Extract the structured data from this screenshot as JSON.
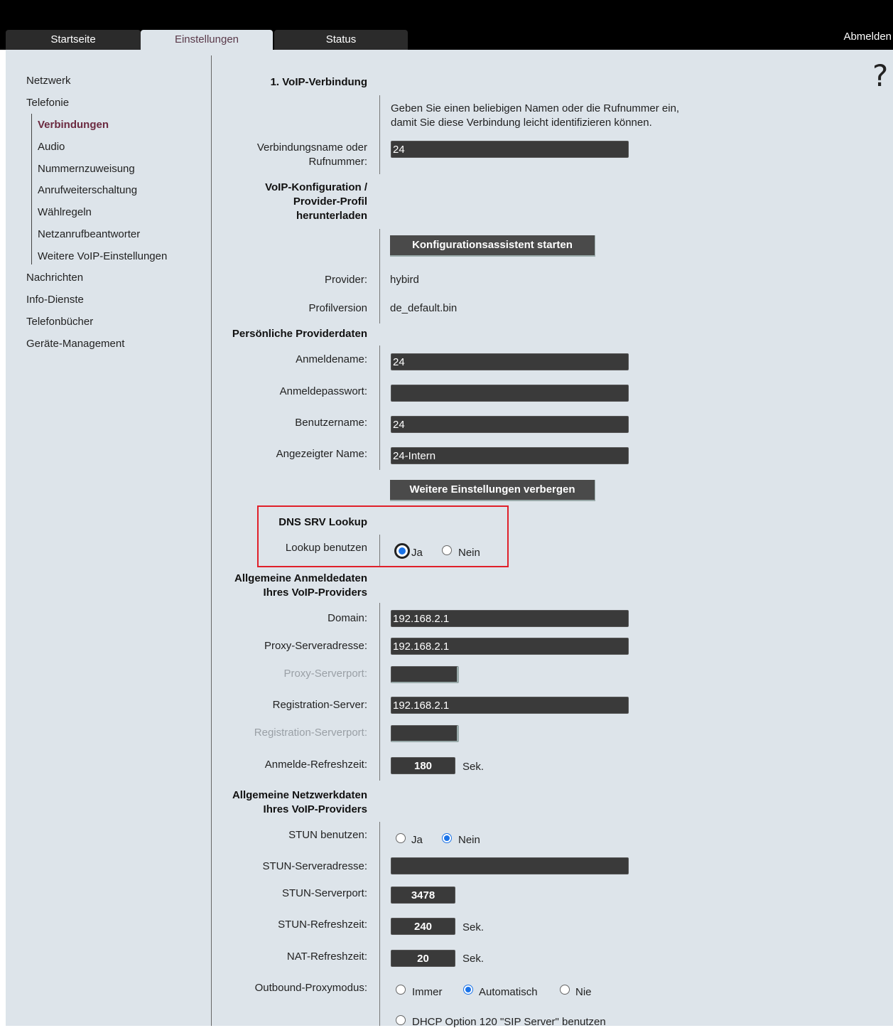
{
  "tabs": [
    {
      "label": "Startseite",
      "active": false
    },
    {
      "label": "Einstellungen",
      "active": true
    },
    {
      "label": "Status",
      "active": false
    }
  ],
  "logout_label": "Abmelden",
  "help_symbol": "?",
  "nav": {
    "items": [
      "Netzwerk",
      "Telefonie"
    ],
    "sub_items": [
      "Verbindungen",
      "Audio",
      "Nummernzuweisung",
      "Anrufweiterschaltung",
      "Wählregeln",
      "Netzanrufbeantworter",
      "Weitere VoIP-Einstellungen"
    ],
    "active_sub": "Verbindungen",
    "items_after": [
      "Nachrichten",
      "Info-Dienste",
      "Telefonbücher",
      "Geräte-Management"
    ]
  },
  "form": {
    "section_voip": "1. VoIP-Verbindung",
    "info_line1": "Geben Sie einen beliebigen Namen oder die Rufnummer ein,",
    "info_line2": "damit Sie diese Verbindung leicht identifizieren können.",
    "conn_name_label1": "Verbindungsname oder",
    "conn_name_label2": "Rufnummer:",
    "conn_name_value": "24",
    "voip_config_l1": "VoIP-Konfiguration /",
    "voip_config_l2": "Provider-Profil",
    "voip_config_l3": "herunterladen",
    "wizard_button": "Konfigurationsassistent starten",
    "provider_label": "Provider:",
    "provider_value": "hybird",
    "profile_label": "Profilversion",
    "profile_value": "de_default.bin",
    "section_personal": "Persönliche Providerdaten",
    "login_name_label": "Anmeldename:",
    "login_name_value": "24",
    "login_pass_label": "Anmeldepasswort:",
    "login_pass_value": "",
    "username_label": "Benutzername:",
    "username_value": "24",
    "display_name_label": "Angezeigter Name:",
    "display_name_value": "24-Intern",
    "more_settings_button": "Weitere Einstellungen verbergen",
    "section_dns": "DNS SRV Lookup",
    "lookup_label": "Lookup benutzen",
    "lookup_options": [
      "Ja",
      "Nein"
    ],
    "lookup_selected": "Ja",
    "section_login_l1": "Allgemeine Anmeldedaten",
    "section_login_l2": "Ihres VoIP-Providers",
    "domain_label": "Domain:",
    "domain_value": "192.168.2.1",
    "proxy_addr_label": "Proxy-Serveradresse:",
    "proxy_addr_value": "192.168.2.1",
    "proxy_port_label": "Proxy-Serverport:",
    "proxy_port_value": "",
    "reg_server_label": "Registration-Server:",
    "reg_server_value": "192.168.2.1",
    "reg_port_label": "Registration-Serverport:",
    "reg_port_value": "",
    "refresh_label": "Anmelde-Refreshzeit:",
    "refresh_value": "180",
    "unit_sec": "Sek.",
    "section_net_l1": "Allgemeine Netzwerkdaten",
    "section_net_l2": "Ihres VoIP-Providers",
    "stun_use_label": "STUN benutzen:",
    "stun_options": [
      "Ja",
      "Nein"
    ],
    "stun_selected": "Nein",
    "stun_addr_label": "STUN-Serveradresse:",
    "stun_addr_value": "",
    "stun_port_label": "STUN-Serverport:",
    "stun_port_value": "3478",
    "stun_refresh_label": "STUN-Refreshzeit:",
    "stun_refresh_value": "240",
    "nat_refresh_label": "NAT-Refreshzeit:",
    "nat_refresh_value": "20",
    "outbound_label": "Outbound-Proxymodus:",
    "outbound_options": [
      "Immer",
      "Automatisch",
      "Nie"
    ],
    "outbound_selected": "Automatisch",
    "dhcp_option_label": "DHCP Option 120 \"SIP Server\" benutzen"
  },
  "colors": {
    "page_bg": "#dde4ea",
    "top_bar": "#000000",
    "active_nav": "#6b2a40",
    "highlight_box": "#e0202a",
    "radio_selected": "#1a73e8"
  }
}
